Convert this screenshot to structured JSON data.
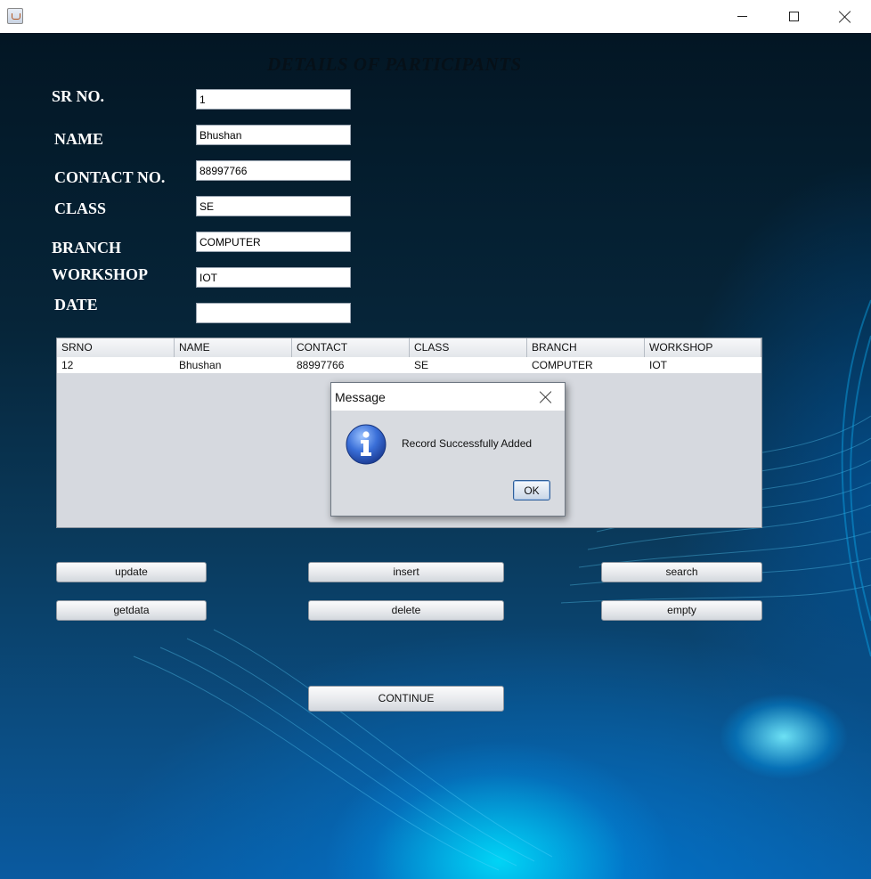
{
  "window": {
    "icon": "java-cup-icon"
  },
  "form": {
    "heading": "DETAILS OF PARTICIPANTS",
    "labels": {
      "sr_no": "SR NO.",
      "name": "NAME",
      "contact": "CONTACT NO.",
      "class": "CLASS",
      "branch": "BRANCH",
      "workshop": "WORKSHOP",
      "date": "DATE"
    },
    "values": {
      "sr_no": "1",
      "name": "Bhushan",
      "contact": "88997766",
      "class": "SE",
      "branch": "COMPUTER",
      "workshop": "IOT",
      "date": ""
    }
  },
  "table": {
    "columns": [
      "SRNO",
      "NAME",
      "CONTACT",
      "CLASS",
      "BRANCH",
      "WORKSHOP"
    ],
    "rows": [
      [
        "12",
        "Bhushan",
        "88997766",
        "SE",
        "COMPUTER",
        "IOT"
      ]
    ]
  },
  "dialog": {
    "title": "Message",
    "message": "Record Successfully Added",
    "ok_label": "OK",
    "icon": "info-icon"
  },
  "buttons": {
    "update": "update",
    "insert": "insert",
    "search": "search",
    "getdata": "getdata",
    "delete": "delete",
    "empty": "empty",
    "continue": "CONTINUE"
  },
  "colors": {
    "background_dark": "#031624",
    "background_glow": "#00e6ff",
    "dialog_bg": "#d8dbe0"
  }
}
